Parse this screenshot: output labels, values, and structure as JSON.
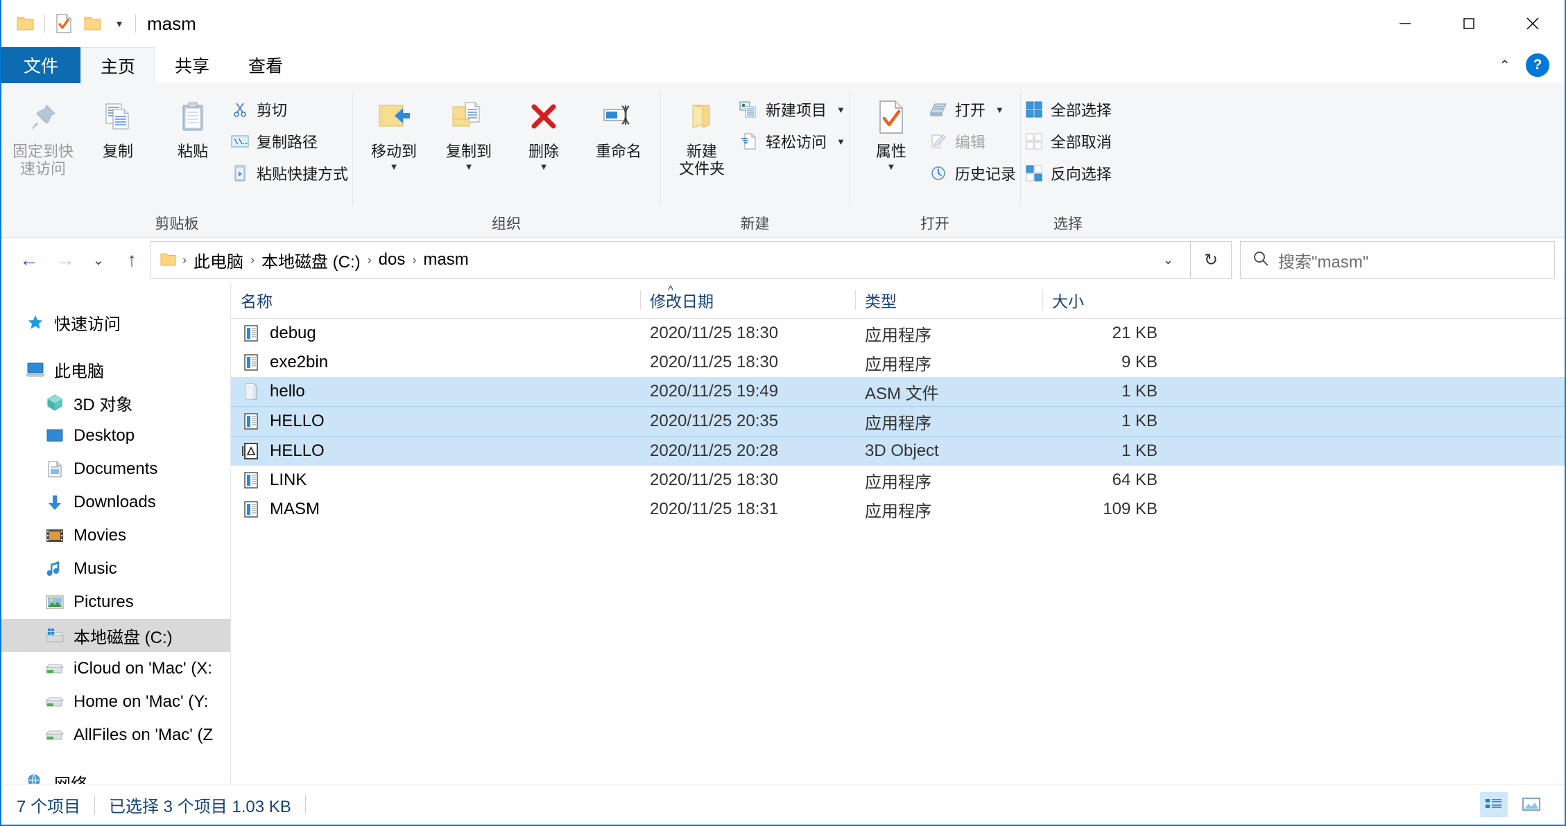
{
  "window": {
    "title": "masm",
    "quick_access": [
      {
        "name": "folder-icon",
        "label": "文件资源管理器"
      },
      {
        "name": "properties-icon",
        "label": "属性"
      },
      {
        "name": "new-folder-icon",
        "label": "新建文件夹"
      }
    ],
    "caption": {
      "minimize": "最小化",
      "maximize": "最大化",
      "close": "关闭"
    }
  },
  "tabs": [
    {
      "label": "文件",
      "kind": "file"
    },
    {
      "label": "主页",
      "kind": "active"
    },
    {
      "label": "共享",
      "kind": "normal"
    },
    {
      "label": "查看",
      "kind": "normal"
    }
  ],
  "ribbon": {
    "groups": [
      {
        "label": "剪贴板",
        "big": [
          {
            "label": "固定到快\n速访问",
            "icon": "pin-icon",
            "dim": true
          },
          {
            "label": "复制",
            "icon": "copy-icon",
            "dim": false
          },
          {
            "label": "粘贴",
            "icon": "paste-icon",
            "dim": false
          }
        ],
        "small": [
          {
            "label": "剪切",
            "icon": "scissors-icon",
            "dim": false
          },
          {
            "label": "复制路径",
            "icon": "copy-path-icon",
            "dim": false
          },
          {
            "label": "粘贴快捷方式",
            "icon": "paste-shortcut-icon",
            "dim": false
          }
        ]
      },
      {
        "label": "组织",
        "big": [
          {
            "label": "移动到",
            "icon": "move-to-icon",
            "caret": true
          },
          {
            "label": "复制到",
            "icon": "copy-to-icon",
            "caret": true
          },
          {
            "label": "删除",
            "icon": "delete-icon",
            "caret": true
          },
          {
            "label": "重命名",
            "icon": "rename-icon",
            "caret": false
          }
        ],
        "small": []
      },
      {
        "label": "新建",
        "big": [
          {
            "label": "新建\n文件夹",
            "icon": "new-folder-icon",
            "caret": false
          }
        ],
        "small": [
          {
            "label": "新建项目",
            "icon": "new-item-icon",
            "caret": true
          },
          {
            "label": "轻松访问",
            "icon": "easy-access-icon",
            "caret": true
          }
        ]
      },
      {
        "label": "打开",
        "big": [
          {
            "label": "属性",
            "icon": "properties-icon",
            "caret": true
          }
        ],
        "small": [
          {
            "label": "打开",
            "icon": "open-icon",
            "caret": true,
            "dim": false
          },
          {
            "label": "编辑",
            "icon": "edit-icon",
            "caret": false,
            "dim": true
          },
          {
            "label": "历史记录",
            "icon": "history-icon",
            "caret": false,
            "dim": false
          }
        ]
      },
      {
        "label": "选择",
        "big": [],
        "small": [
          {
            "label": "全部选择",
            "icon": "select-all-icon"
          },
          {
            "label": "全部取消",
            "icon": "select-none-icon"
          },
          {
            "label": "反向选择",
            "icon": "invert-selection-icon"
          }
        ]
      }
    ]
  },
  "address": {
    "back": "后退",
    "forward": "前进",
    "recent": "最近浏览位置",
    "up": "上移到",
    "breadcrumbs": [
      "此电脑",
      "本地磁盘 (C:)",
      "dos",
      "masm"
    ],
    "separator": "›",
    "refresh": "刷新"
  },
  "search": {
    "placeholder": "搜索\"masm\""
  },
  "nav_pane": {
    "items": [
      {
        "label": "快速访问",
        "icon": "star-icon",
        "indent": false,
        "selected": false,
        "gap_after": true
      },
      {
        "label": "此电脑",
        "icon": "computer-icon",
        "indent": false,
        "selected": false
      },
      {
        "label": "3D 对象",
        "icon": "3d-objects-icon",
        "indent": true,
        "selected": false
      },
      {
        "label": "Desktop",
        "icon": "desktop-icon",
        "indent": true,
        "selected": false
      },
      {
        "label": "Documents",
        "icon": "documents-icon",
        "indent": true,
        "selected": false
      },
      {
        "label": "Downloads",
        "icon": "downloads-icon",
        "indent": true,
        "selected": false
      },
      {
        "label": "Movies",
        "icon": "movies-icon",
        "indent": true,
        "selected": false
      },
      {
        "label": "Music",
        "icon": "music-icon",
        "indent": true,
        "selected": false
      },
      {
        "label": "Pictures",
        "icon": "pictures-icon",
        "indent": true,
        "selected": false
      },
      {
        "label": "本地磁盘 (C:)",
        "icon": "local-disk-icon",
        "indent": true,
        "selected": true
      },
      {
        "label": "iCloud on 'Mac' (X:",
        "icon": "network-drive-icon",
        "indent": true,
        "selected": false
      },
      {
        "label": "Home on 'Mac' (Y:",
        "icon": "network-drive-icon",
        "indent": true,
        "selected": false
      },
      {
        "label": "AllFiles on 'Mac' (Z",
        "icon": "network-drive-icon",
        "indent": true,
        "selected": false,
        "gap_after": true
      },
      {
        "label": "网络",
        "icon": "network-icon",
        "indent": false,
        "selected": false
      }
    ]
  },
  "file_list": {
    "columns": [
      {
        "label": "名称",
        "key": "name"
      },
      {
        "label": "修改日期",
        "key": "date"
      },
      {
        "label": "类型",
        "key": "type"
      },
      {
        "label": "大小",
        "key": "size"
      }
    ],
    "sort_indicator": "^",
    "rows": [
      {
        "name": "debug",
        "date": "2020/11/25 18:30",
        "type": "应用程序",
        "size": "21 KB",
        "icon": "application-icon",
        "selected": false
      },
      {
        "name": "exe2bin",
        "date": "2020/11/25 18:30",
        "type": "应用程序",
        "size": "9 KB",
        "icon": "application-icon",
        "selected": false
      },
      {
        "name": "hello",
        "date": "2020/11/25 19:49",
        "type": "ASM 文件",
        "size": "1 KB",
        "icon": "asm-file-icon",
        "selected": true
      },
      {
        "name": "HELLO",
        "date": "2020/11/25 20:35",
        "type": "应用程序",
        "size": "1 KB",
        "icon": "application-icon",
        "selected": true
      },
      {
        "name": "HELLO",
        "date": "2020/11/25 20:28",
        "type": "3D Object",
        "size": "1 KB",
        "icon": "3d-object-icon",
        "selected": true
      },
      {
        "name": "LINK",
        "date": "2020/11/25 18:30",
        "type": "应用程序",
        "size": "64 KB",
        "icon": "application-icon",
        "selected": false
      },
      {
        "name": "MASM",
        "date": "2020/11/25 18:31",
        "type": "应用程序",
        "size": "109 KB",
        "icon": "application-icon",
        "selected": false
      }
    ]
  },
  "status": {
    "item_count": "7 个项目",
    "selection": "已选择 3 个项目  1.03 KB",
    "view_details": "详细信息视图",
    "view_large": "大图标视图"
  },
  "colors": {
    "accent": "#0078d7",
    "file_tab": "#0d6bb2",
    "selection": "#cce4f7",
    "nav_selection": "#d9d9d9",
    "header_text": "#14427a",
    "ribbon_bg": "#f4f6f8"
  }
}
